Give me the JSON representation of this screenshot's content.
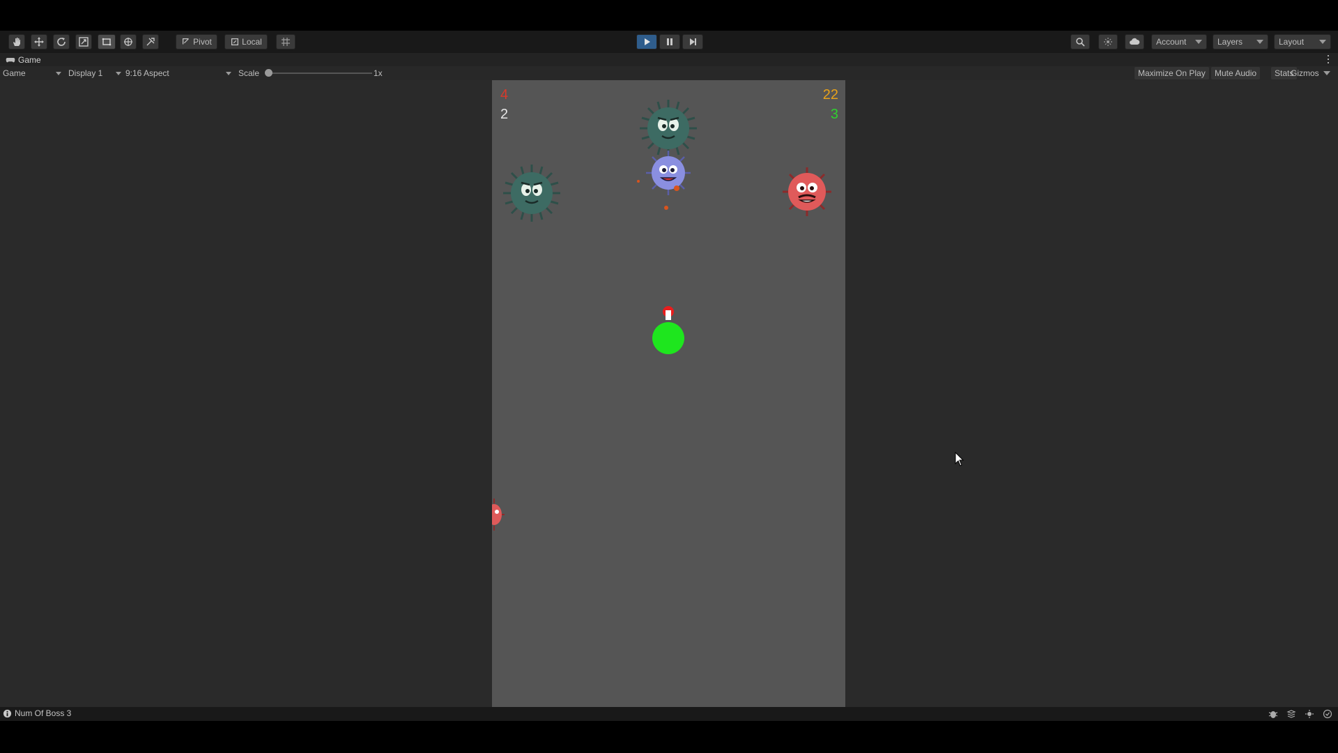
{
  "toolbar": {
    "tools": [
      {
        "name": "hand-tool-icon"
      },
      {
        "name": "move-tool-icon"
      },
      {
        "name": "rotate-tool-icon"
      },
      {
        "name": "scale-tool-icon"
      },
      {
        "name": "rect-tool-icon",
        "active": true
      },
      {
        "name": "transform-tool-icon"
      },
      {
        "name": "custom-tool-icon"
      }
    ],
    "pivot_label": "Pivot",
    "local_label": "Local",
    "account_label": "Account",
    "layers_label": "Layers",
    "layout_label": "Layout"
  },
  "tab": {
    "title": "Game"
  },
  "game_bar": {
    "mode": "Game",
    "display": "Display 1",
    "aspect": "9:16 Aspect",
    "scale_label": "Scale",
    "scale_value": "1x",
    "maximize_label": "Maximize On Play",
    "mute_label": "Mute Audio",
    "stats_label": "Stats",
    "gizmos_label": "Gizmos"
  },
  "hud": {
    "top_left_red": "4",
    "top_left_white": "2",
    "top_right_yellow": "22",
    "top_right_green": "3"
  },
  "colors": {
    "hud_red": "#d93a2b",
    "hud_white": "#e6e6e6",
    "hud_yellow": "#e8a21a",
    "hud_green": "#2fd12f",
    "player": "#1ee61e",
    "player_cap": "#e81d1d",
    "virus_teal": "#3d6b63",
    "virus_purple": "#8a8fe0",
    "virus_red": "#e05a5a",
    "play_active": "#2f5d8c"
  },
  "status": {
    "message": "Num Of Boss 3"
  }
}
